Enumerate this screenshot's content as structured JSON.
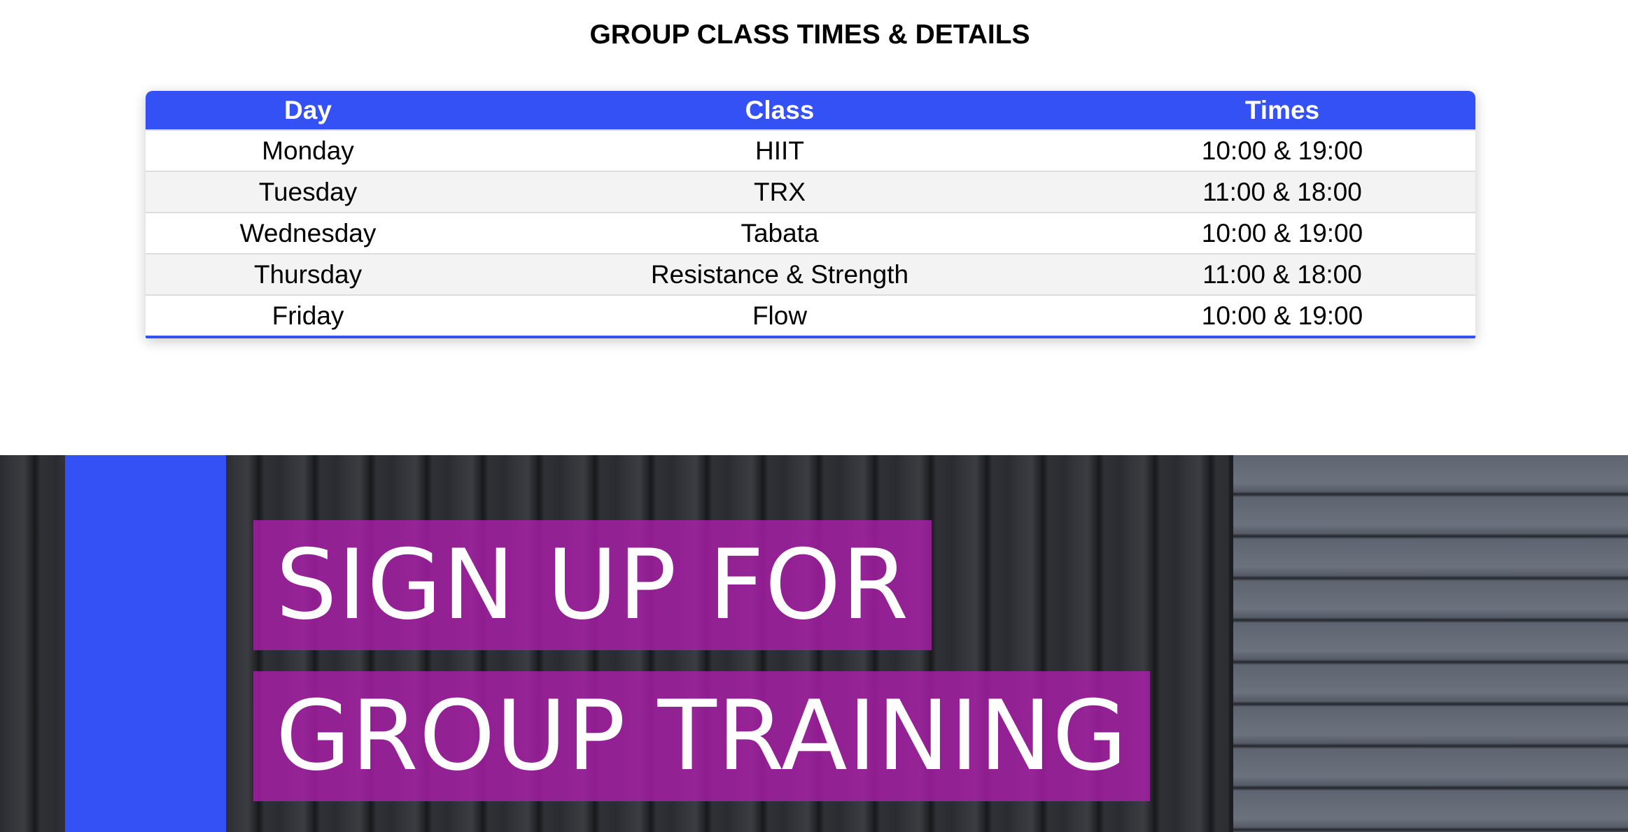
{
  "heading": "GROUP CLASS TIMES & DETAILS",
  "table": {
    "headers": [
      "Day",
      "Class",
      "Times"
    ],
    "rows": [
      [
        "Monday",
        "HIIT",
        "10:00 & 19:00"
      ],
      [
        "Tuesday",
        "TRX",
        "11:00 & 18:00"
      ],
      [
        "Wednesday",
        "Tabata",
        "10:00 & 19:00"
      ],
      [
        "Thursday",
        "Resistance & Strength",
        "11:00 & 18:00"
      ],
      [
        "Friday",
        "Flow",
        "10:00 & 19:00"
      ]
    ]
  },
  "banner": {
    "line1": "SIGN UP FOR",
    "line2": "GROUP TRAINING"
  },
  "colors": {
    "accent_blue": "#3451f5",
    "banner_magenta": "#aa1eaa",
    "row_alt": "#f3f3f3"
  }
}
